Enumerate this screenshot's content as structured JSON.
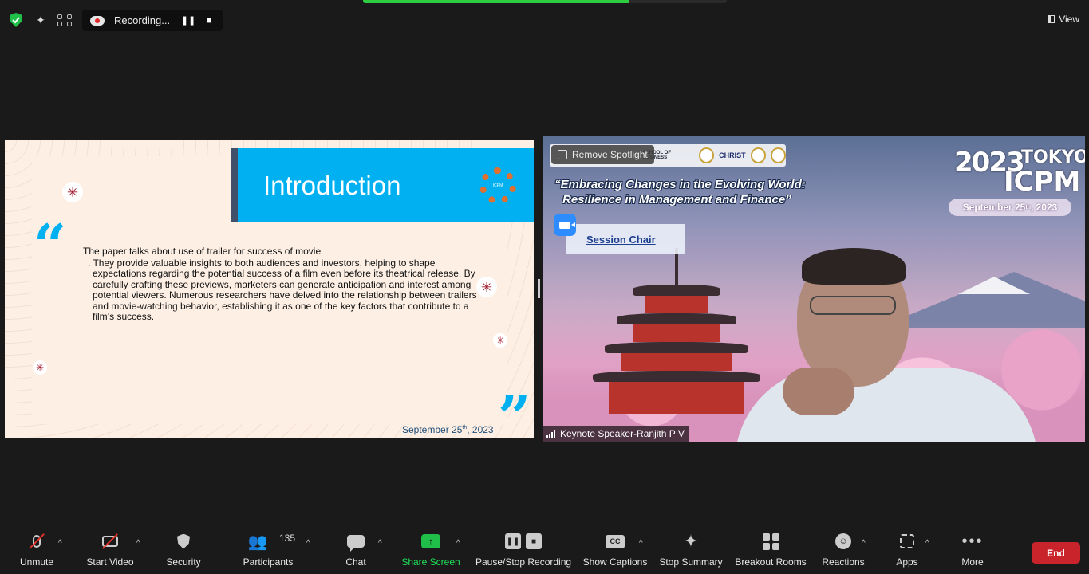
{
  "top_progress": {
    "fraction": 0.73
  },
  "topbar": {
    "security_icon": "shield-check-icon",
    "ai_icon": "sparkle-icon",
    "apps_icon": "grid-icon",
    "recording_label": "Recording...",
    "view_label": "View"
  },
  "slide": {
    "title": "Introduction",
    "logo_text": "ICPM",
    "open_quote": "“",
    "close_quote": "”",
    "para1": "The paper talks about use of trailer for success of movie",
    "para2": ". They provide valuable insights to both audiences and investors, helping to shape expectations regarding the potential success of a film even before its theatrical release. By carefully crafting these previews, marketers can generate anticipation and interest among potential viewers.  Numerous researchers have delved into the relationship between trailers and movie-watching behavior, establishing it as one of the key factors that contribute to a film’s success.",
    "date_prefix": "September 25",
    "date_sup": "th",
    "date_suffix": ", 2023",
    "flower_glyph": "✳"
  },
  "speaker": {
    "remove_spotlight": "Remove Spotlight",
    "strip_school": "SCHOOL OF BUSINESS",
    "strip_christ": "CHRIST",
    "theme_line1": "“Embracing Changes in the Evolving World:",
    "theme_line2": "Resilience in Management and Finance”",
    "brand_year": "2023",
    "brand_city": "TOKYO",
    "brand_name": "ICPM",
    "date_prefix": "September 25",
    "date_sup": "th",
    "date_suffix": ", 2023",
    "session_chair": "Session Chair",
    "name_tag": "Keynote Speaker-Ranjith P V"
  },
  "toolbar": {
    "unmute": "Unmute",
    "start_video": "Start Video",
    "security": "Security",
    "participants": "Participants",
    "participants_count": "135",
    "chat": "Chat",
    "share_screen": "Share Screen",
    "pause_stop": "Pause/Stop Recording",
    "captions": "Show Captions",
    "captions_glyph": "CC",
    "summary": "Stop Summary",
    "breakout": "Breakout Rooms",
    "reactions": "Reactions",
    "apps": "Apps",
    "more": "More",
    "end": "End"
  },
  "colors": {
    "accent_blue": "#00b0f0",
    "end_red": "#c9232b",
    "share_green": "#1fbf4a"
  }
}
